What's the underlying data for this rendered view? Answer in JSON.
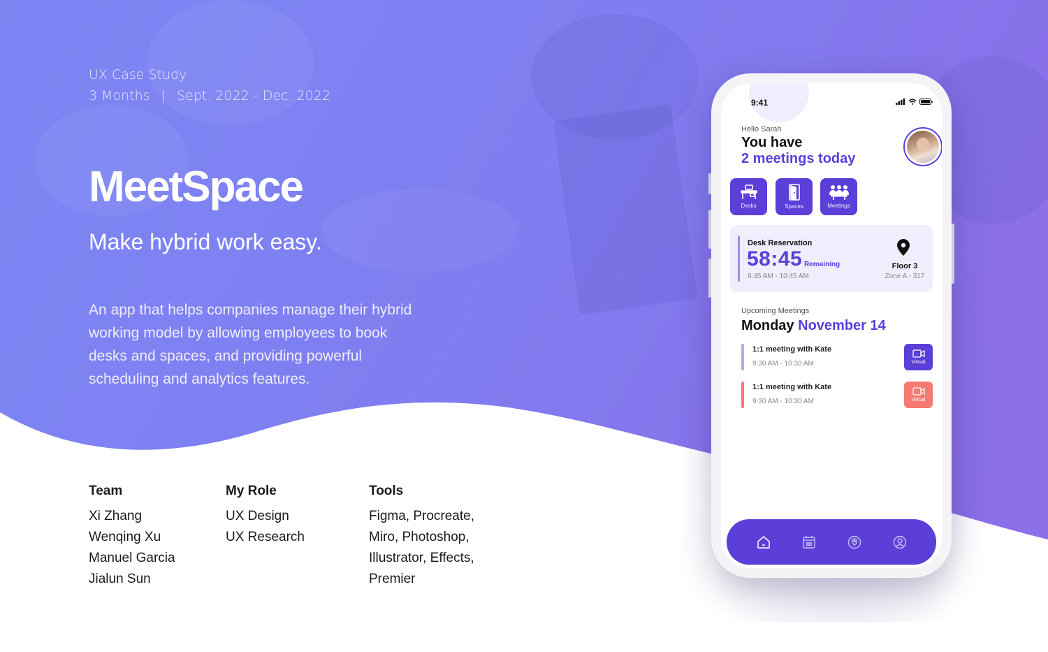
{
  "case_study": {
    "label": "UX Case Study",
    "duration": "3 Months",
    "separator": "|",
    "dates": "Sept. 2022 - Dec. 2022"
  },
  "brand": {
    "name": "MeetSpace",
    "tagline": "Make hybrid work easy.",
    "description": "An app that helps companies manage their hybrid working model by allowing employees to book desks and spaces, and providing powerful scheduling and analytics features."
  },
  "team": {
    "heading": "Team",
    "members": [
      "Xi Zhang",
      "Wenqing Xu",
      "Manuel Garcia",
      "Jialun Sun"
    ]
  },
  "role": {
    "heading": "My Role",
    "items": [
      "UX Design",
      "UX Research"
    ]
  },
  "tools": {
    "heading": "Tools",
    "lines": [
      "Figma, Procreate,",
      "Miro, Photoshop,",
      "Illustrator, Effects,",
      "Premier"
    ]
  },
  "app": {
    "status_time": "9:41",
    "greeting": "Hello Sarah",
    "headline_1": "You have",
    "headline_2": "2 meetings today",
    "quick_actions": [
      {
        "label": "Desks",
        "icon": "desk-icon"
      },
      {
        "label": "Spaces",
        "icon": "door-icon"
      },
      {
        "label": "Meetings",
        "icon": "people-icon"
      }
    ],
    "reservation": {
      "title": "Desk Reservation",
      "timer": "58:45",
      "remaining_label": "Remaining",
      "time_range": "9:45 AM - 10:45 AM",
      "floor": "Floor 3",
      "zone": "Zone A - 317"
    },
    "upcoming": {
      "label": "Upcoming Meetings",
      "day": "Monday",
      "date": "November 14",
      "meetings": [
        {
          "title": "1:1 meeting with Kate",
          "time": "9:30 AM - 10:30 AM",
          "type": "Virtual",
          "color": "#5b3fd8",
          "bar_color": "#b3a8ee"
        },
        {
          "title": "1:1 meeting with Kate",
          "time": "9:30 AM - 10:30 AM",
          "type": "Virtual",
          "color": "#f47a72",
          "bar_color": "#f47a72"
        }
      ]
    },
    "nav": [
      "home-icon",
      "calendar-icon",
      "location-icon",
      "profile-icon"
    ]
  },
  "colors": {
    "brand_purple": "#5b3fd8",
    "hero_gradient_start": "#6b7cf0",
    "hero_gradient_end": "#8a6ee8",
    "coral": "#f47a72"
  }
}
